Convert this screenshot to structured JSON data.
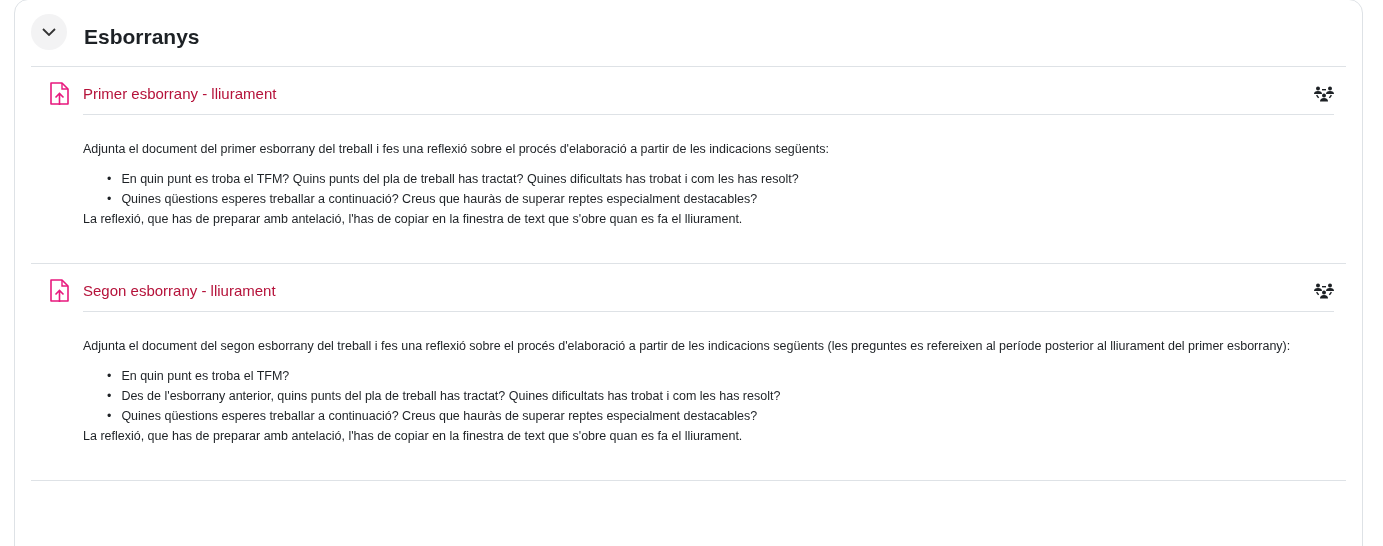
{
  "section": {
    "title": "Esborranys",
    "expanded": true
  },
  "activities": [
    {
      "title": "Primer esborrany - lliurament",
      "intro": "Adjunta el document del primer esborrany del treball i fes una reflexió sobre el procés d'elaboració a partir de les indicacions següents:",
      "bullets": [
        {
          "marker": "•",
          "text": "En quin punt es troba el TFM? Quins punts del pla de treball has tractat? Quines dificultats has trobat i com les has resolt?"
        },
        {
          "marker": "•",
          "text": "Quines qüestions esperes treballar a continuació? Creus que hauràs de superar reptes especialment destacables?"
        }
      ],
      "outro": "La reflexió, que has de preparar amb antelació, l'has de copiar en la finestra de text que s'obre quan es fa el lliurament."
    },
    {
      "title": "Segon esborrany - lliurament",
      "intro": "Adjunta el document del segon esborrany del treball i fes una reflexió sobre el procés d'elaboració a partir de les indicacions següents (les preguntes es refereixen al període posterior al lliurament del primer esborrany):",
      "bullets": [
        {
          "marker": "•",
          "text": "En quin punt es troba el TFM?"
        },
        {
          "marker": "•",
          "text": "Des de l'esborrany anterior, quins punts del pla de treball has tractat? Quines dificultats has trobat i com les has resolt?"
        },
        {
          "marker": "•",
          "text": "Quines qüestions esperes treballar a continuació? Creus que hauràs de superar reptes especialment destacables?"
        }
      ],
      "outro": "La reflexió, que has de preparar amb antelació, l'has de copiar en la finestra de text que s'obre quan es fa el lliurament."
    }
  ]
}
